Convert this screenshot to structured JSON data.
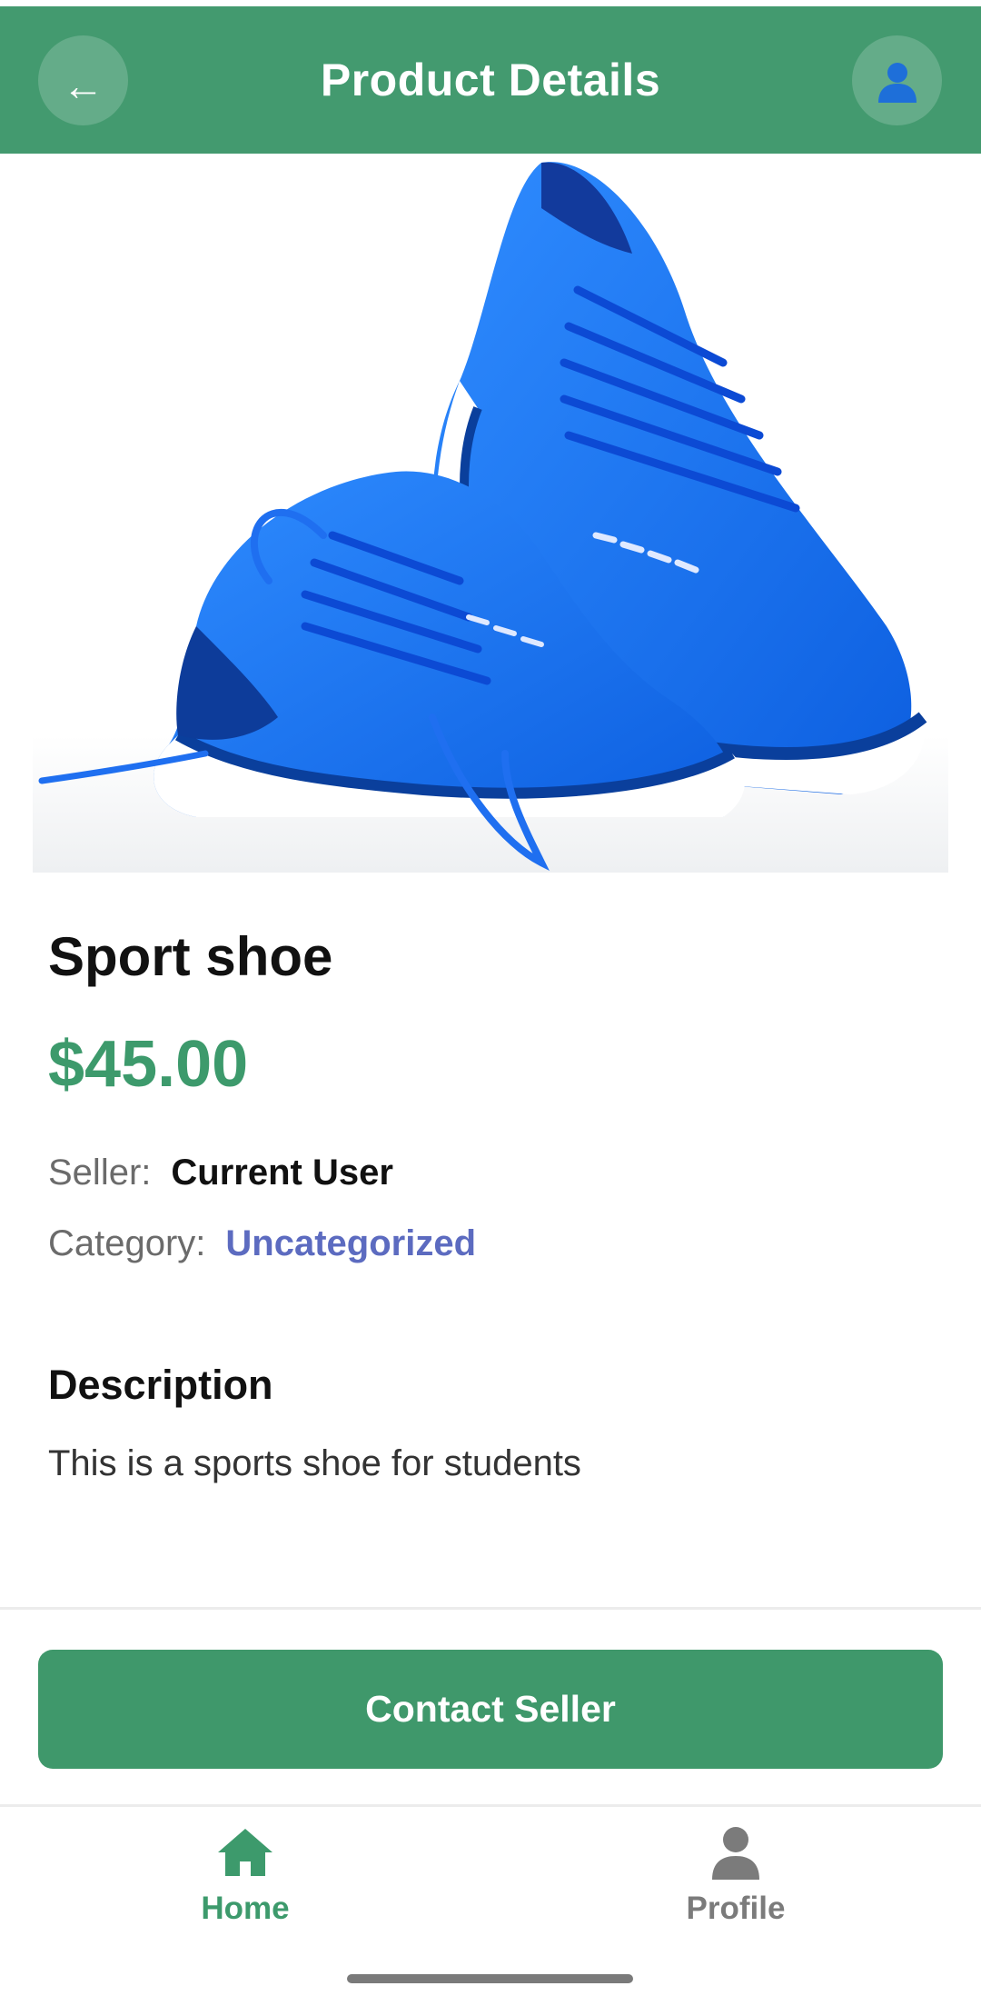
{
  "header": {
    "title": "Product Details",
    "back_icon": "←",
    "profile_icon": "person-icon"
  },
  "product": {
    "image": "blue-running-shoes",
    "name": "Sport shoe",
    "price": "$45.00",
    "seller_label": "Seller:",
    "seller_value": "Current User",
    "category_label": "Category:",
    "category_value": "Uncategorized",
    "description_heading": "Description",
    "description_text": "This is a sports shoe for students"
  },
  "actions": {
    "contact_label": "Contact Seller"
  },
  "bottom_nav": {
    "items": [
      {
        "label": "Home",
        "icon": "home-icon",
        "active": true
      },
      {
        "label": "Profile",
        "icon": "person-icon",
        "active": false
      }
    ]
  },
  "colors": {
    "primary": "#439a6f",
    "price": "#3d9a6c",
    "link": "#5c6bc0",
    "inactive": "#7b7b7b"
  }
}
